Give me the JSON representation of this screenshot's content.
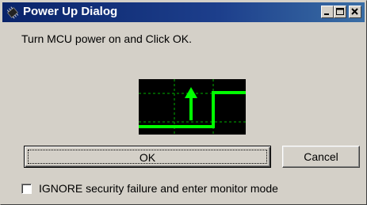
{
  "window": {
    "title": "Power Up Dialog",
    "title_icon": "chip-icon",
    "controls": {
      "minimize_icon": "minimize-icon",
      "maximize_icon": "maximize-icon",
      "close_icon": "close-icon"
    }
  },
  "body": {
    "prompt": "Turn MCU power on and Click OK.",
    "diagram_icon": "power-on-signal-icon",
    "diagram_colors": {
      "background": "#000000",
      "signal": "#00ff00",
      "grid": "#00c000"
    }
  },
  "buttons": {
    "ok_label": "OK",
    "cancel_label": "Cancel"
  },
  "options": {
    "ignore_security_label": "IGNORE security failure and enter monitor mode",
    "ignore_security_checked": false
  },
  "colors": {
    "titlebar_start": "#0a246a",
    "titlebar_end": "#3a6ea5",
    "face": "#d4d0c8"
  }
}
